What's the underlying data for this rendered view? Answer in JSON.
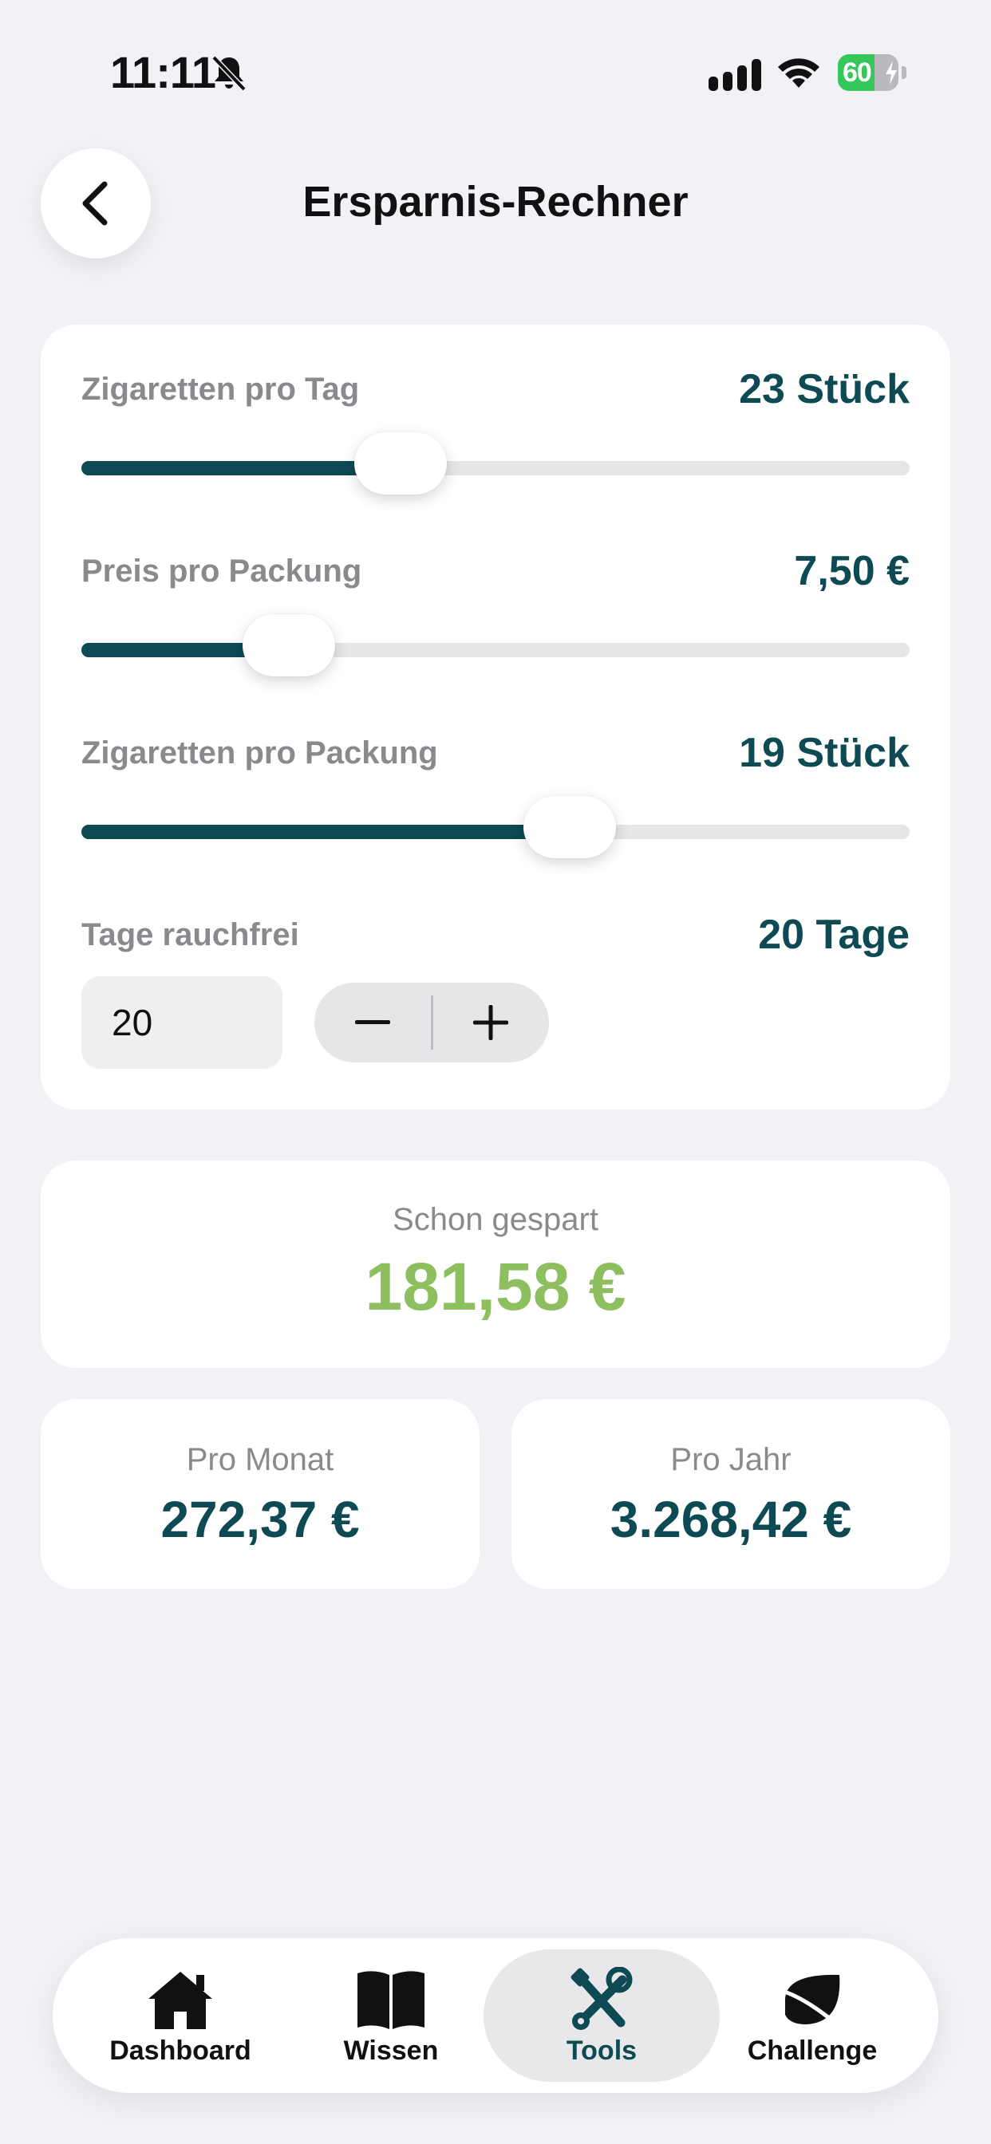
{
  "status_bar": {
    "time": "11:11",
    "battery": "60",
    "battery_level": 0.6
  },
  "header": {
    "title": "Ersparnis-Rechner",
    "back_icon": "chevron-left-icon"
  },
  "settings": {
    "cigarettes_per_day": {
      "label": "Zigaretten pro Tag",
      "value_text": "23 Stück",
      "slider_fraction": 0.385
    },
    "price_per_pack": {
      "label": "Preis pro Packung",
      "value_text": "7,50 €",
      "slider_fraction": 0.25
    },
    "cigarettes_per_pack": {
      "label": "Zigaretten pro Packung",
      "value_text": "19 Stück",
      "slider_fraction": 0.59
    },
    "days_smoke_free": {
      "label": "Tage rauchfrei",
      "value_text": "20 Tage",
      "input_value": "20"
    }
  },
  "savings": {
    "saved_label": "Schon gespart",
    "saved_value": "181,58 €",
    "month_label": "Pro Monat",
    "month_value": "272,37 €",
    "year_label": "Pro Jahr",
    "year_value": "3.268,42 €"
  },
  "colors": {
    "accent": "#0d4a54",
    "saved_green": "#8dbf5f",
    "background": "#f1f1f6"
  },
  "tab_bar": {
    "active": "Tools",
    "items": [
      {
        "label": "Dashboard",
        "icon": "house-icon"
      },
      {
        "label": "Wissen",
        "icon": "book-icon"
      },
      {
        "label": "Tools",
        "icon": "tools-icon"
      },
      {
        "label": "Challenge",
        "icon": "leaf-icon"
      }
    ]
  }
}
